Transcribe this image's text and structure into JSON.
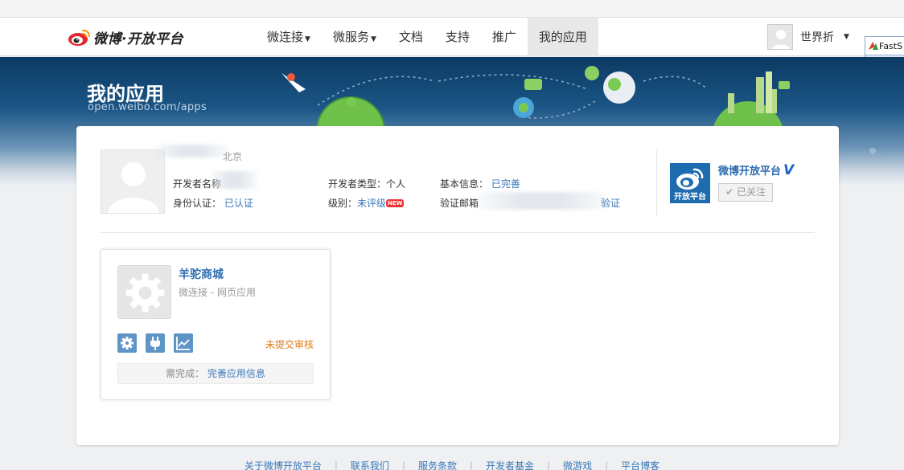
{
  "brand": {
    "logo_text": "微博·开放平台"
  },
  "nav": {
    "items": [
      {
        "label": "微连接",
        "has_menu": true
      },
      {
        "label": "微服务",
        "has_menu": true
      },
      {
        "label": "文档",
        "has_menu": false
      },
      {
        "label": "支持",
        "has_menu": false
      },
      {
        "label": "推广",
        "has_menu": false
      },
      {
        "label": "我的应用",
        "has_menu": false,
        "active": true
      }
    ]
  },
  "user": {
    "name": "世界折"
  },
  "widget": {
    "title": "FastS"
  },
  "banner": {
    "title": "我的应用",
    "subtitle": "open.weibo.com/apps"
  },
  "profile": {
    "location": "北京",
    "developer_name_label": "开发者名称",
    "identity_label": "身份认证：",
    "identity_value": "已认证",
    "developer_type_label": "开发者类型：",
    "developer_type_value": "个人",
    "level_label": "级别：",
    "level_value": "未评级",
    "level_badge": "NEW",
    "basic_info_label": "基本信息：",
    "basic_info_value": "已完善",
    "email_label": "验证邮箱",
    "email_value": "验证"
  },
  "official": {
    "name": "微博开放平台",
    "v_badge": "V",
    "logo_caption": "开放平台",
    "follow_label": "已关注"
  },
  "app": {
    "name": "羊驼商城",
    "type": "微连接 - 网页应用",
    "status": "未提交审核",
    "todo_label": "需完成：",
    "todo_link": "完善应用信息",
    "tools": [
      "gear-icon",
      "plug-icon",
      "chart-icon"
    ]
  },
  "footer": {
    "links": [
      "关于微博开放平台",
      "联系我们",
      "服务条款",
      "开发者基金",
      "微游戏",
      "平台博客"
    ]
  },
  "colors": {
    "link": "#3a78b8",
    "status_orange": "#e07a16",
    "tool_blue": "#5f94c7",
    "banner_dark": "#0c3a63"
  }
}
